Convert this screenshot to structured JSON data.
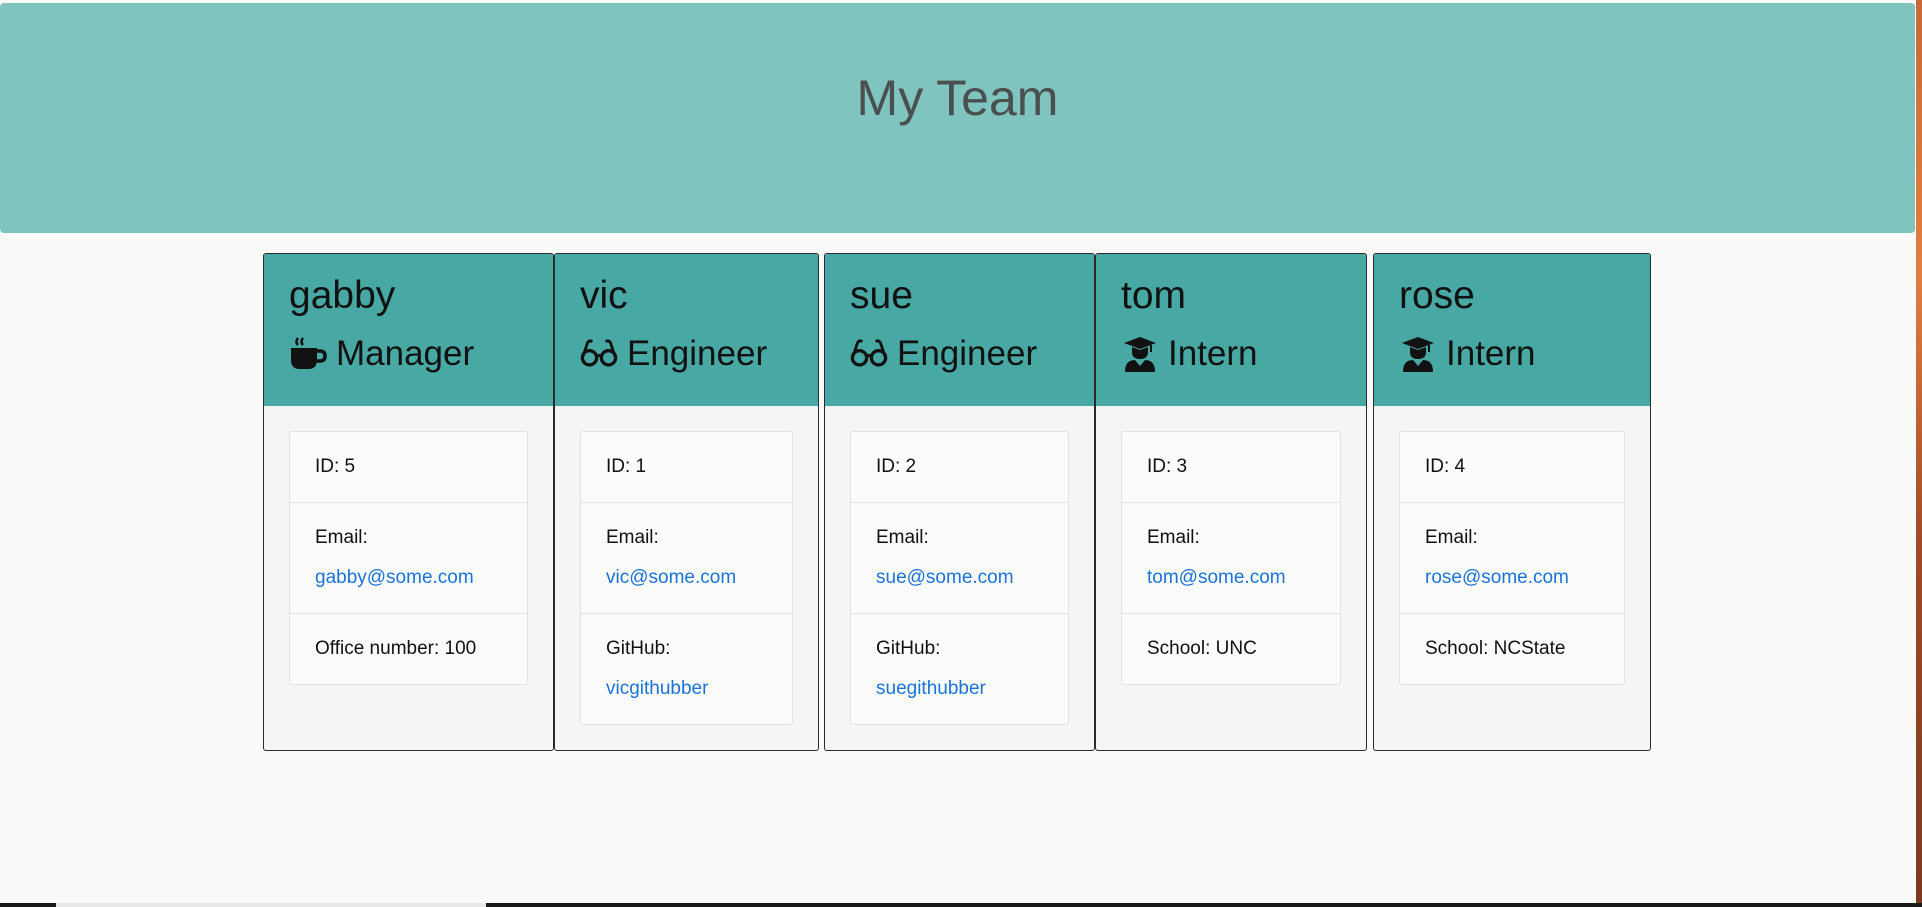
{
  "header": {
    "title": "My Team"
  },
  "labels": {
    "id_prefix": "ID: ",
    "email": "Email:",
    "github": "GitHub:"
  },
  "employees": [
    {
      "name": "gabby",
      "role": "Manager",
      "icon": "coffee-icon",
      "id_text": "ID: 5",
      "email": "gabby@some.com",
      "extra": "Office number: 100"
    },
    {
      "name": "vic",
      "role": "Engineer",
      "icon": "glasses-icon",
      "id_text": "ID: 1",
      "email": "vic@some.com",
      "github": "vicgithubber"
    },
    {
      "name": "sue",
      "role": "Engineer",
      "icon": "glasses-icon",
      "id_text": "ID: 2",
      "email": "sue@some.com",
      "github": "suegithubber"
    },
    {
      "name": "tom",
      "role": "Intern",
      "icon": "graduate-icon",
      "id_text": "ID: 3",
      "email": "tom@some.com",
      "extra": "School: UNC"
    },
    {
      "name": "rose",
      "role": "Intern",
      "icon": "graduate-icon",
      "id_text": "ID: 4",
      "email": "rose@some.com",
      "extra": "School: NCState"
    }
  ],
  "colors": {
    "jumbotron": "#80c4bf",
    "card_header": "#48a8a3",
    "link": "#1a73d9"
  }
}
